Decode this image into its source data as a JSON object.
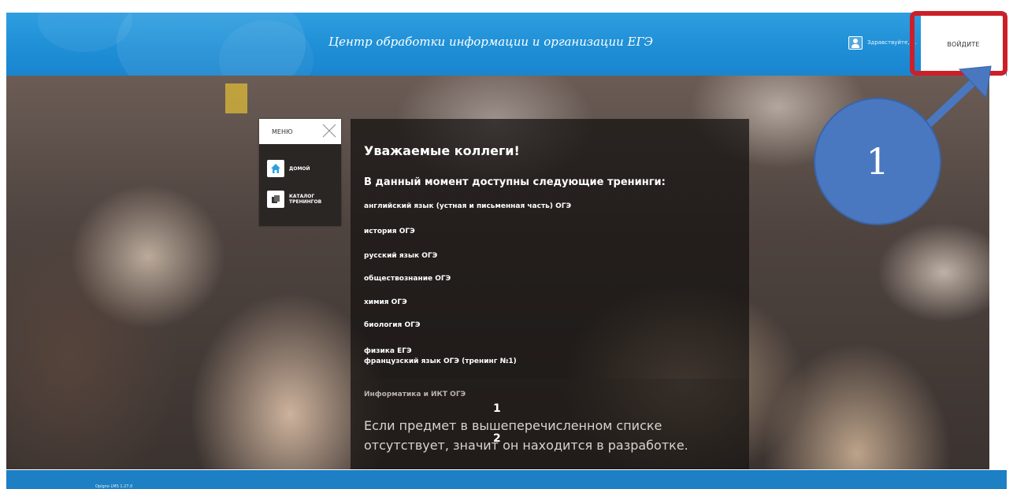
{
  "header": {
    "title": "Центр обработки информации и организации ЕГЭ",
    "greeting": "Здравствуйте, ...",
    "login_label": "ВОЙДИТЕ"
  },
  "menu": {
    "title": "МЕНЮ",
    "items": [
      {
        "label": "ДОМОЙ",
        "icon": "home-icon"
      },
      {
        "label": "КАТАЛОГ\nТРЕНИНГОВ",
        "icon": "catalog-icon"
      }
    ]
  },
  "content": {
    "heading": "Уважаемые коллеги!",
    "subheading": "В данный момент доступны следующие тренинги:",
    "courses": [
      "английский язык (устная и письменная часть) ОГЭ",
      "история ОГЭ",
      "русский язык ОГЭ",
      "обществознание ОГЭ",
      "химия ОГЭ",
      "биология ОГЭ",
      "физика ЕГЭ",
      "французский язык ОГЭ (тренинг №1)",
      "Информатика и ИКТ ОГЭ"
    ],
    "note": "Если предмет в вышеперечисленном списке отсутствует, значит он находится в разработке.",
    "mark_1": "1",
    "mark_2": "2"
  },
  "callout": {
    "label": "1",
    "color": "#4a78c0"
  },
  "highlight_color": "#cc1f28",
  "footer": {
    "version": "Opigno LMS 1.27.0"
  }
}
